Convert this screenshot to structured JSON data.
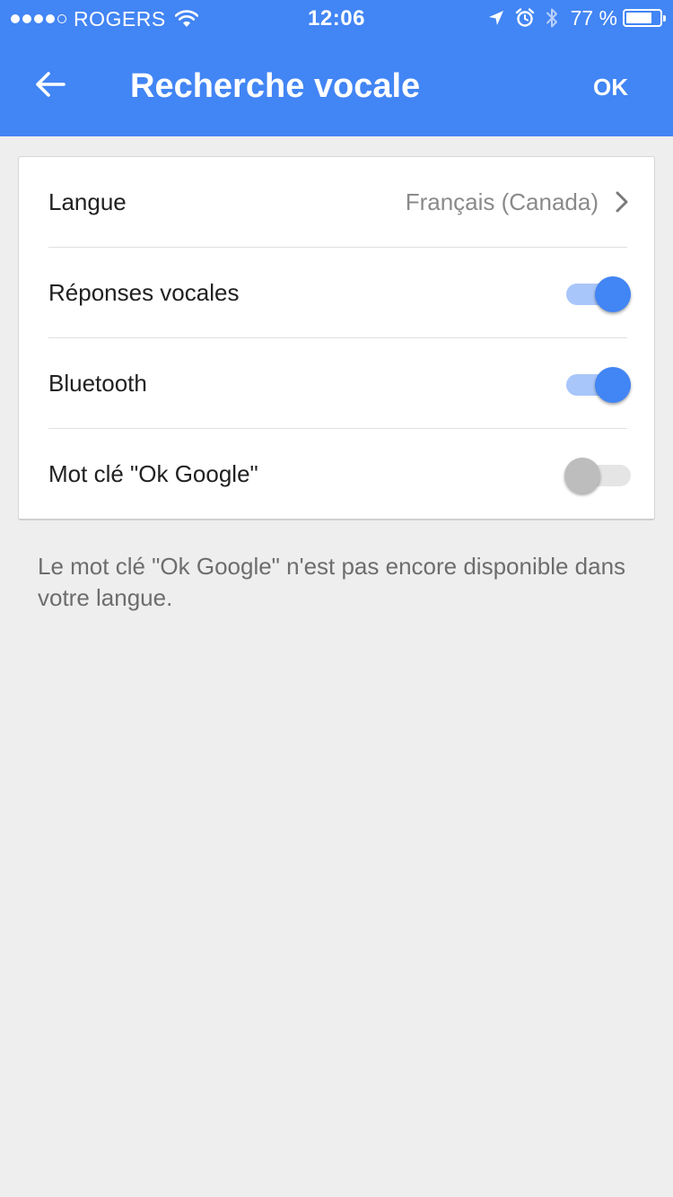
{
  "status_bar": {
    "signal_filled": 4,
    "signal_total": 5,
    "carrier": "ROGERS",
    "time": "12:06",
    "battery_text": "77 %",
    "battery_level": 0.77,
    "icons": [
      "wifi-icon",
      "location-arrow-icon",
      "alarm-icon",
      "bluetooth-icon",
      "battery-icon"
    ]
  },
  "app_bar": {
    "back_icon": "arrow-back-icon",
    "title": "Recherche vocale",
    "ok_label": "OK"
  },
  "settings": {
    "langue": {
      "label": "Langue",
      "value": "Français (Canada)",
      "icon": "chevron-right-icon"
    },
    "reponses_vocales": {
      "label": "Réponses vocales",
      "enabled": true
    },
    "bluetooth": {
      "label": "Bluetooth",
      "enabled": true
    },
    "ok_google": {
      "label": "Mot clé \"Ok Google\"",
      "enabled": false
    }
  },
  "footnote": "Le mot clé \"Ok Google\" n'est pas encore disponible dans votre langue.",
  "colors": {
    "primary": "#4285f4",
    "toggle_track_on": "#a9c6fa",
    "toggle_knob_off": "#bdbdbd",
    "background": "#eeeeee"
  }
}
